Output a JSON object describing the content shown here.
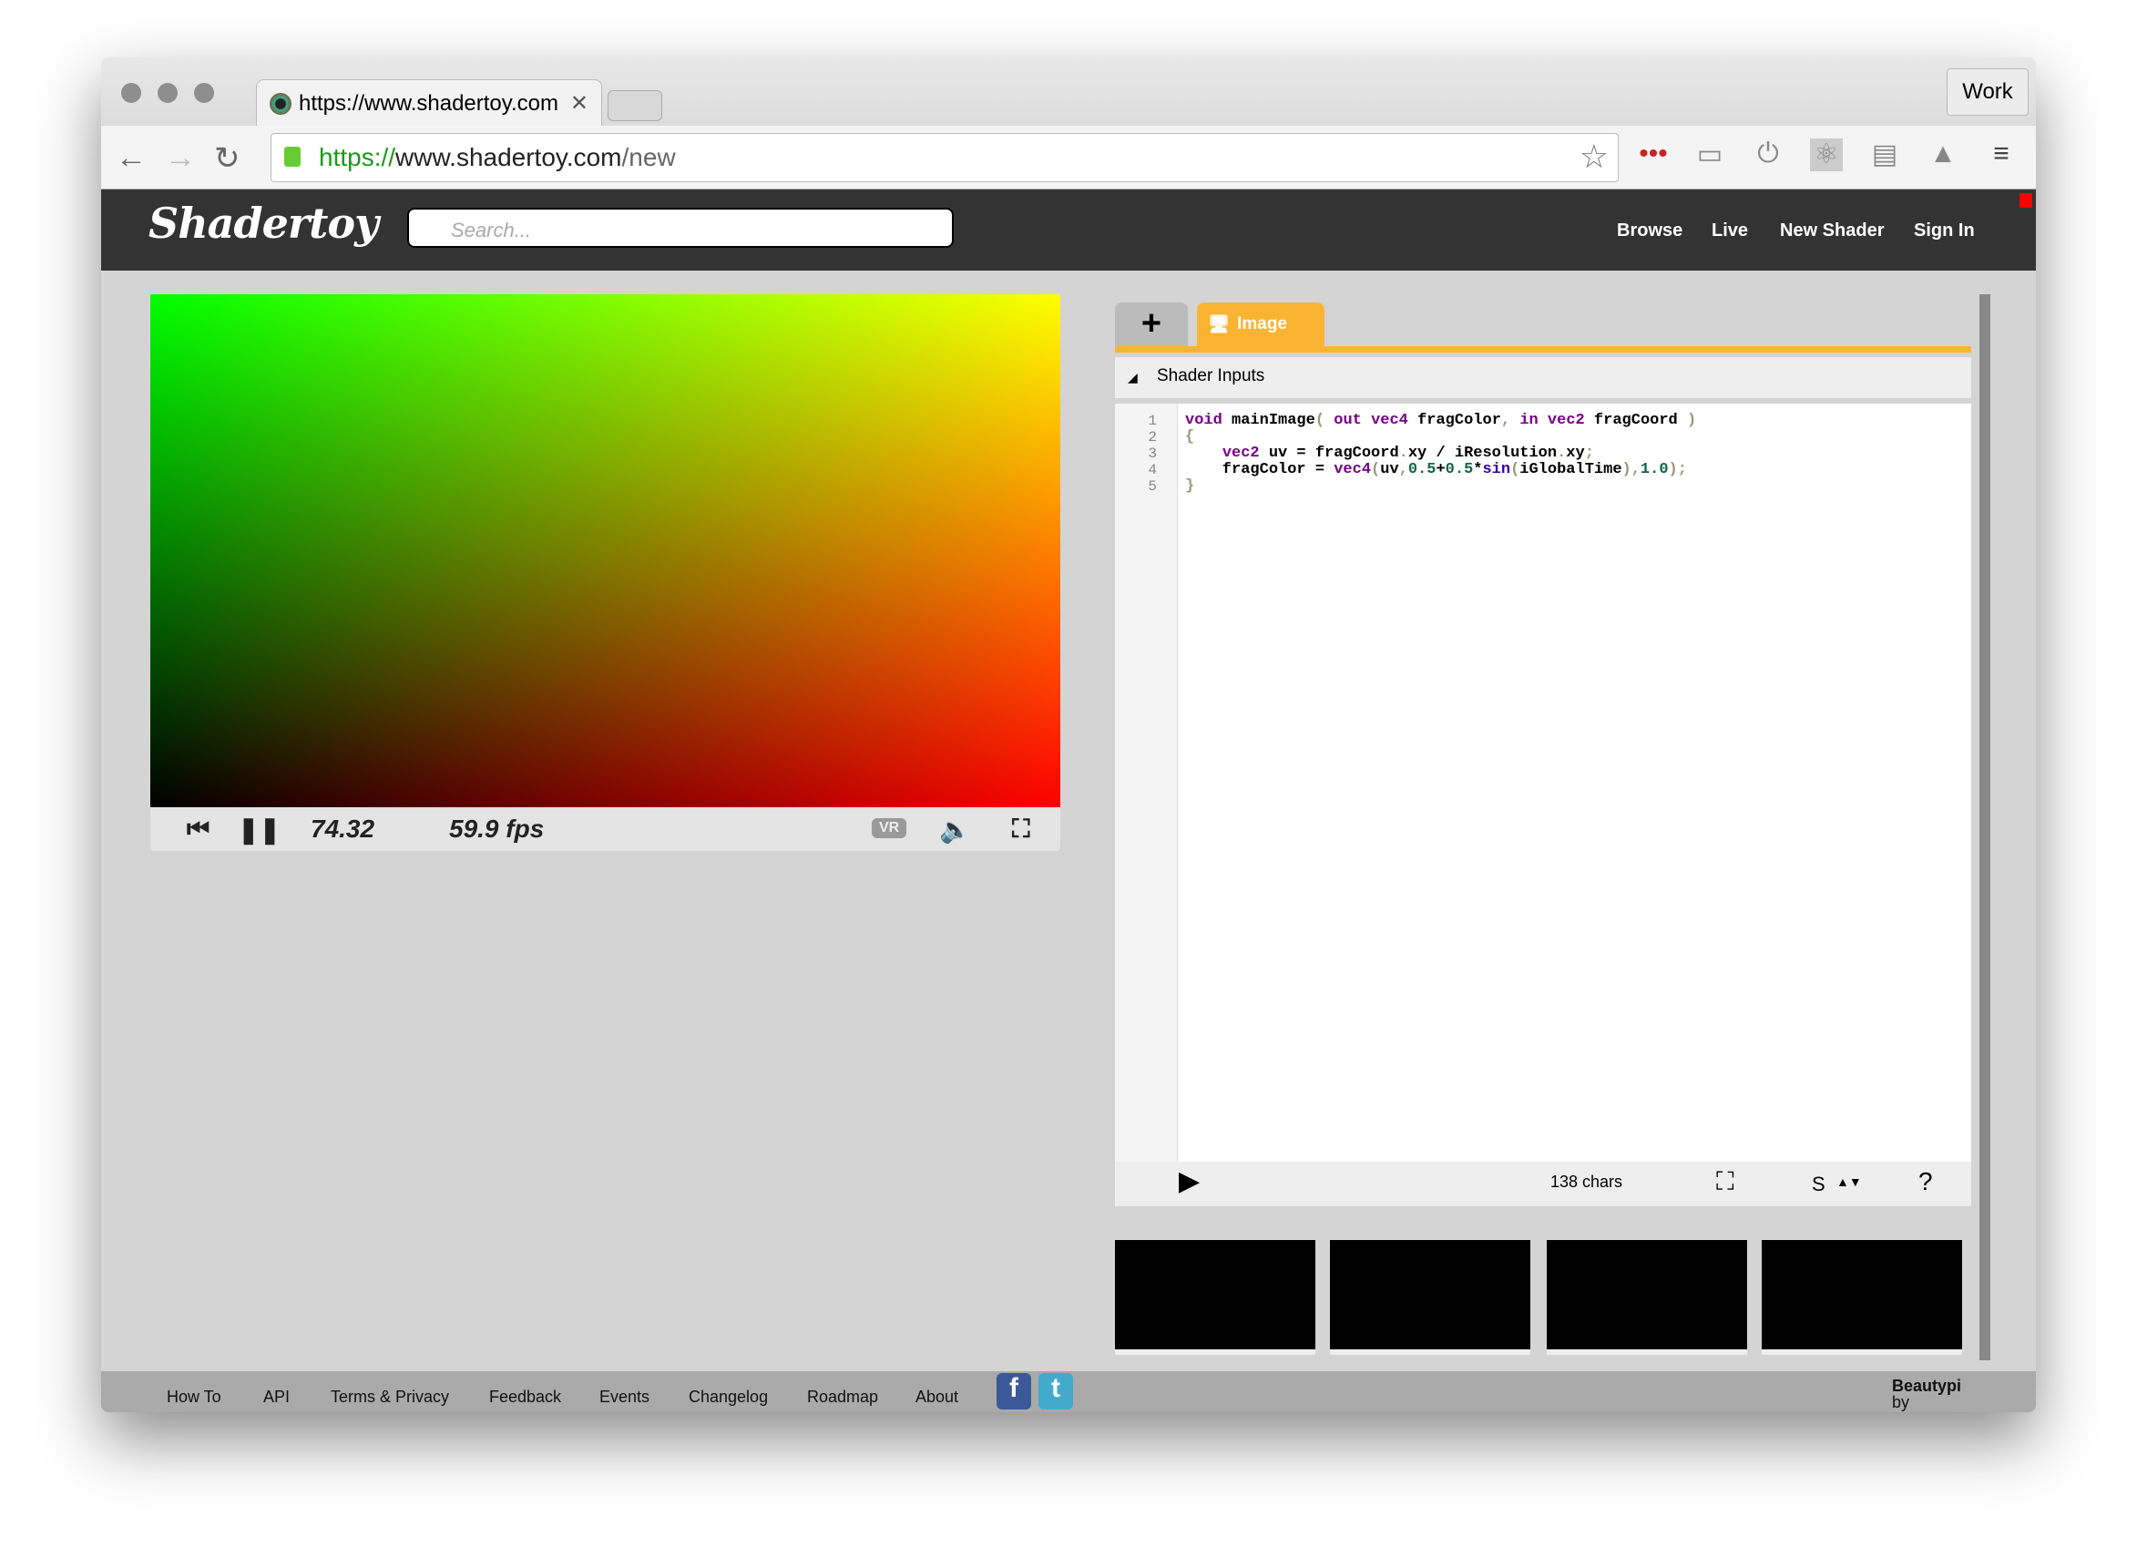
{
  "browser": {
    "tab_title": "https://www.shadertoy.com",
    "profile": "Work",
    "url_scheme": "https://",
    "url_host": "www.shadertoy.com",
    "url_path": "/new"
  },
  "site": {
    "logo": "Shadertoy",
    "search_placeholder": "Search...",
    "nav": [
      "Browse",
      "Live",
      "New Shader",
      "Sign In"
    ]
  },
  "player": {
    "time": "74.32",
    "fps": "59.9 fps",
    "vr_label": "VR"
  },
  "editor": {
    "add_tab": "+",
    "tab_label": "Image",
    "inputs_label": "Shader Inputs",
    "char_count": "138 chars",
    "font_label": "S",
    "help": "?",
    "line_numbers": [
      "1",
      "2",
      "3",
      "4",
      "5"
    ]
  },
  "footer": {
    "links": [
      "How To",
      "API",
      "Terms & Privacy",
      "Feedback",
      "Events",
      "Changelog",
      "Roadmap",
      "About"
    ],
    "by": "by",
    "author": "Beautypi"
  },
  "colors": {
    "accent": "#fab432",
    "header": "#333333"
  }
}
